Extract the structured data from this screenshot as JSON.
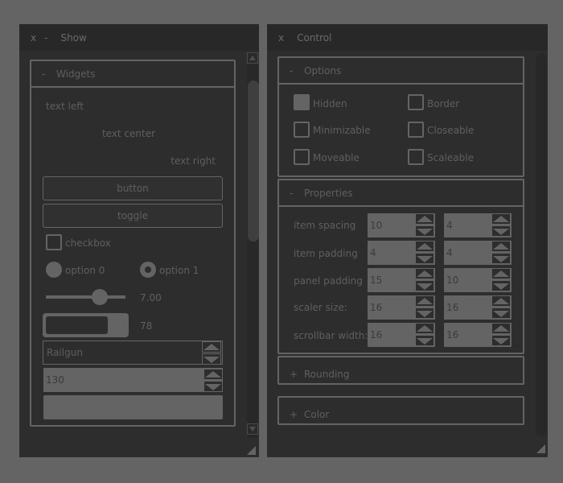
{
  "show_window": {
    "close_label": "x",
    "minimize_label": "-",
    "title": "Show",
    "widgets_group": {
      "toggle_symbol": "-",
      "title": "Widgets",
      "text_left": "text left",
      "text_center": "text center",
      "text_right": "text right",
      "button_label": "button",
      "toggle_label": "toggle",
      "checkbox_label": "checkbox",
      "checkbox_checked": false,
      "radio_options": [
        {
          "label": "option 0",
          "selected": false
        },
        {
          "label": "option 1",
          "selected": true
        }
      ],
      "slider_value_text": "7.00",
      "slider_fraction": 0.7,
      "progress_value_text": "78",
      "progress_fraction": 0.78,
      "combo_value": "Railgun",
      "spinner_value": "130",
      "empty_field_value": ""
    }
  },
  "control_window": {
    "close_label": "x",
    "title": "Control",
    "options_group": {
      "toggle_symbol": "-",
      "title": "Options",
      "items": [
        {
          "label": "Hidden",
          "checked": true
        },
        {
          "label": "Border",
          "checked": false
        },
        {
          "label": "Minimizable",
          "checked": false
        },
        {
          "label": "Closeable",
          "checked": false
        },
        {
          "label": "Moveable",
          "checked": false
        },
        {
          "label": "Scaleable",
          "checked": false
        }
      ]
    },
    "properties_group": {
      "toggle_symbol": "-",
      "title": "Properties",
      "rows": [
        {
          "label": "item spacing",
          "x": "10",
          "y": "4"
        },
        {
          "label": "item padding",
          "x": "4",
          "y": "4"
        },
        {
          "label": "panel padding",
          "x": "15",
          "y": "10"
        },
        {
          "label": "scaler size:",
          "x": "16",
          "y": "16"
        },
        {
          "label": "scrollbar width:",
          "x": "16",
          "y": "16"
        }
      ]
    },
    "rounding_group": {
      "toggle_symbol": "+",
      "title": "Rounding"
    },
    "color_group": {
      "toggle_symbol": "+",
      "title": "Color"
    }
  },
  "colors": {
    "background": "#646464",
    "window": "#2d2d2d",
    "header": "#282828",
    "accent": "#646464",
    "text": "#5f5f5f"
  }
}
